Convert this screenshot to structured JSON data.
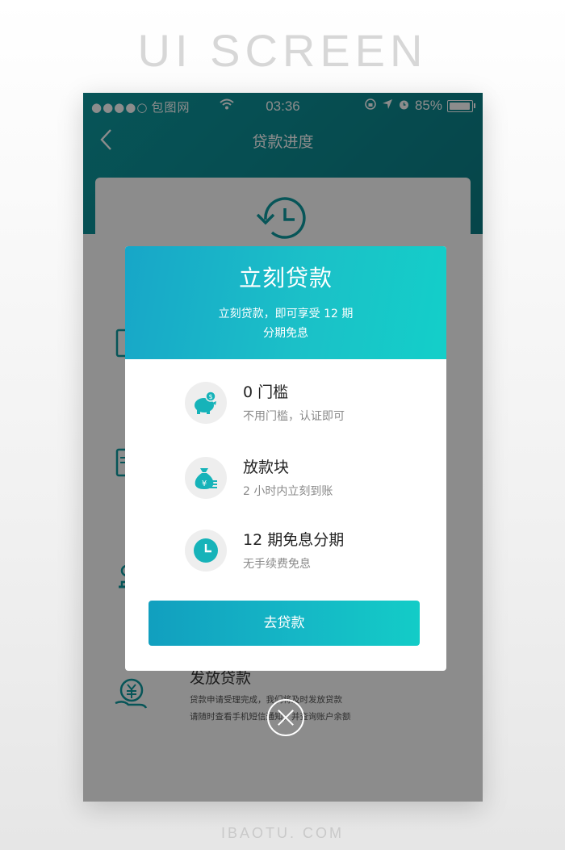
{
  "banner": {
    "title": "UI SCREEN",
    "site": "IBAOTU. COM"
  },
  "status_bar": {
    "signal": "●●●●○",
    "carrier": "包图网",
    "time": "03:36",
    "battery": "85%"
  },
  "nav": {
    "title": "贷款进度"
  },
  "background": {
    "step_title": "发放贷款",
    "step_desc_line1": "贷款申请受理完成，我们将及时发放贷款",
    "step_desc_line2": "请随时查看手机短信通知，并查询账户余额"
  },
  "modal": {
    "title": "立刻贷款",
    "subtitle_line1": "立刻贷款，即可享受 12 期",
    "subtitle_line2": "分期免息",
    "features": [
      {
        "title": "0 门槛",
        "desc": "不用门槛，认证即可",
        "icon": "piggy-bank-icon"
      },
      {
        "title": "放款块",
        "desc": "2 小时内立刻到账",
        "icon": "money-bag-icon"
      },
      {
        "title": "12 期免息分期",
        "desc": "无手续费免息",
        "icon": "clock-icon"
      }
    ],
    "cta_label": "去贷款"
  },
  "colors": {
    "teal": "#17b4c6",
    "header": "#0d9aa0",
    "icon_teal": "#16b3b9"
  }
}
